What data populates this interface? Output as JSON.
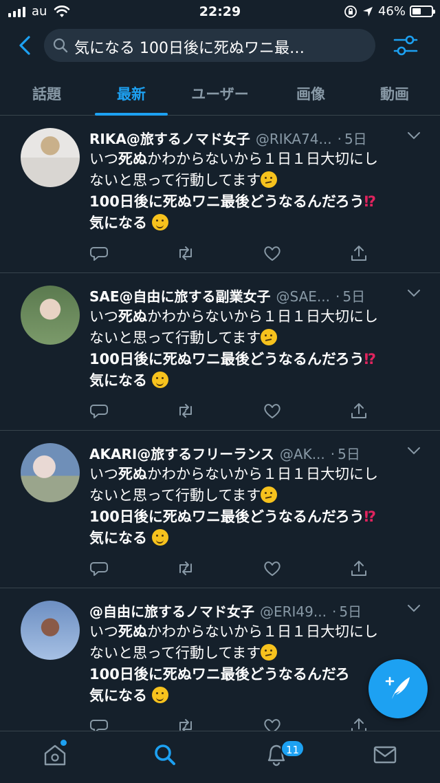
{
  "status_bar": {
    "carrier": "au",
    "time": "22:29",
    "battery": "46%",
    "battery_level": 0.46
  },
  "search": {
    "query": "気になる 100日後に死ぬワニ最…"
  },
  "tabs": [
    {
      "label": "話題",
      "active": false
    },
    {
      "label": "最新",
      "active": true
    },
    {
      "label": "ユーザー",
      "active": false
    },
    {
      "label": "画像",
      "active": false
    },
    {
      "label": "動画",
      "active": false
    }
  ],
  "tweets": [
    {
      "name": "RIKA@旅するノマド女子",
      "handle": "@RIKA74...",
      "time": "5日",
      "line1_a": "いつ",
      "line1_b": "死ぬ",
      "line1_c": "かわからないから１日１日大切にし",
      "line2": "ないと思って行動してます",
      "line3": "100日後に死ぬワニ最後どうなるんだろう",
      "line3_end": "⁉",
      "line4": "気になる"
    },
    {
      "name": "SAE@自由に旅する副業女子",
      "handle": "@SAE...",
      "time": "5日",
      "line1_a": "いつ",
      "line1_b": "死ぬ",
      "line1_c": "かわからないから１日１日大切にし",
      "line2": "ないと思って行動してます",
      "line3": "100日後に死ぬワニ最後どうなるんだろう",
      "line3_end": "⁉",
      "line4": "気になる"
    },
    {
      "name": "AKARI@旅するフリーランス",
      "handle": "@AK...",
      "time": "5日",
      "line1_a": "いつ",
      "line1_b": "死ぬ",
      "line1_c": "かわからないから１日１日大切にし",
      "line2": "ないと思って行動してます",
      "line3": "100日後に死ぬワニ最後どうなるんだろう",
      "line3_end": "⁉",
      "line4": "気になる"
    },
    {
      "name": "@自由に旅するノマド女子",
      "handle": "@ERI49...",
      "time": "5日",
      "line1_a": "いつ",
      "line1_b": "死ぬ",
      "line1_c": "かわからないから１日１日大切にし",
      "line2": "ないと思って行動してます",
      "line3": "100日後に死ぬワニ最後どうなるんだろ",
      "line3_end": "",
      "line4": "気になる"
    }
  ],
  "nav": {
    "notification_count": "11"
  },
  "colors": {
    "background": "#15202b",
    "accent": "#1da1f2",
    "muted": "#8899a6",
    "divider": "#38444d"
  }
}
